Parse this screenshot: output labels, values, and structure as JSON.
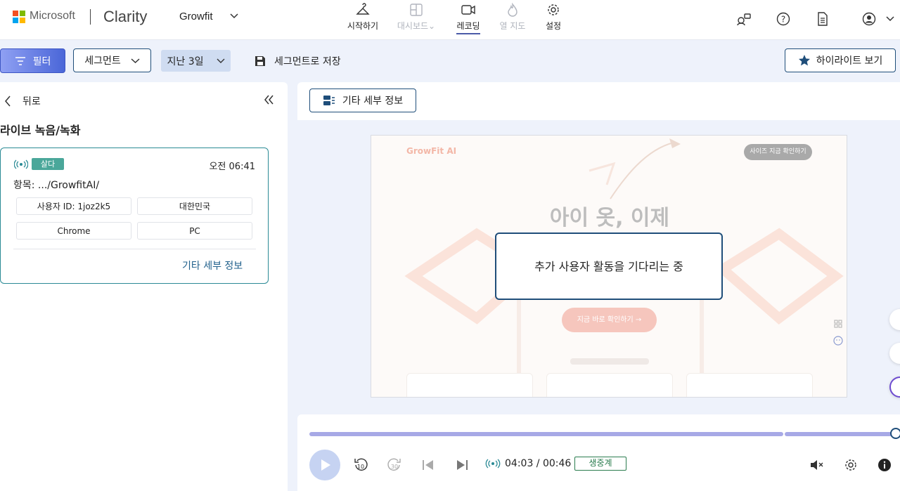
{
  "brand": {
    "microsoft": "Microsoft",
    "product": "Clarity",
    "project": "Growfit"
  },
  "nav": [
    {
      "label": "시작하기",
      "icon": "hanger-icon",
      "state": "normal"
    },
    {
      "label": "대시보드",
      "icon": "dashboard-icon",
      "state": "disabled"
    },
    {
      "label": "레코딩",
      "icon": "video-camera-icon",
      "state": "active"
    },
    {
      "label": "열 지도",
      "icon": "flame-icon",
      "state": "disabled"
    },
    {
      "label": "설정",
      "icon": "gear-icon",
      "state": "normal"
    }
  ],
  "toolbar": {
    "filter": "필터",
    "segment": "세그먼트",
    "date_range": "지난 3일",
    "save_segment": "세그먼트로 저장",
    "highlights": "하이라이트 보기"
  },
  "left": {
    "back": "뒤로",
    "title": "라이브 녹음/녹화",
    "card": {
      "badge": "살다",
      "time": "오전 06:41",
      "entry": "항목: .../GrowfitAI/",
      "chips": [
        "사용자 ID: 1joz2k5",
        "대한민국",
        "Chrome",
        "PC"
      ],
      "more": "기타 세부 정보"
    }
  },
  "main": {
    "details_button": "기타 세부 정보",
    "modal": "추가 사용자 활동을 기다리는 중"
  },
  "viewport": {
    "logo": "GrowFit AI",
    "top_pill": "사이즈 지금 확인하기",
    "headline": "아이 옷, 이제",
    "cta": "지금 바로 확인하기 →"
  },
  "player": {
    "time": "04:03 / 00:46",
    "live": "생중계",
    "progress": 1.0,
    "back_seconds": "10",
    "forward_seconds": "30"
  },
  "colors": {
    "accent": "#1f4e7a",
    "live_green": "#2b7d4f",
    "badge": "#4aa79a"
  }
}
